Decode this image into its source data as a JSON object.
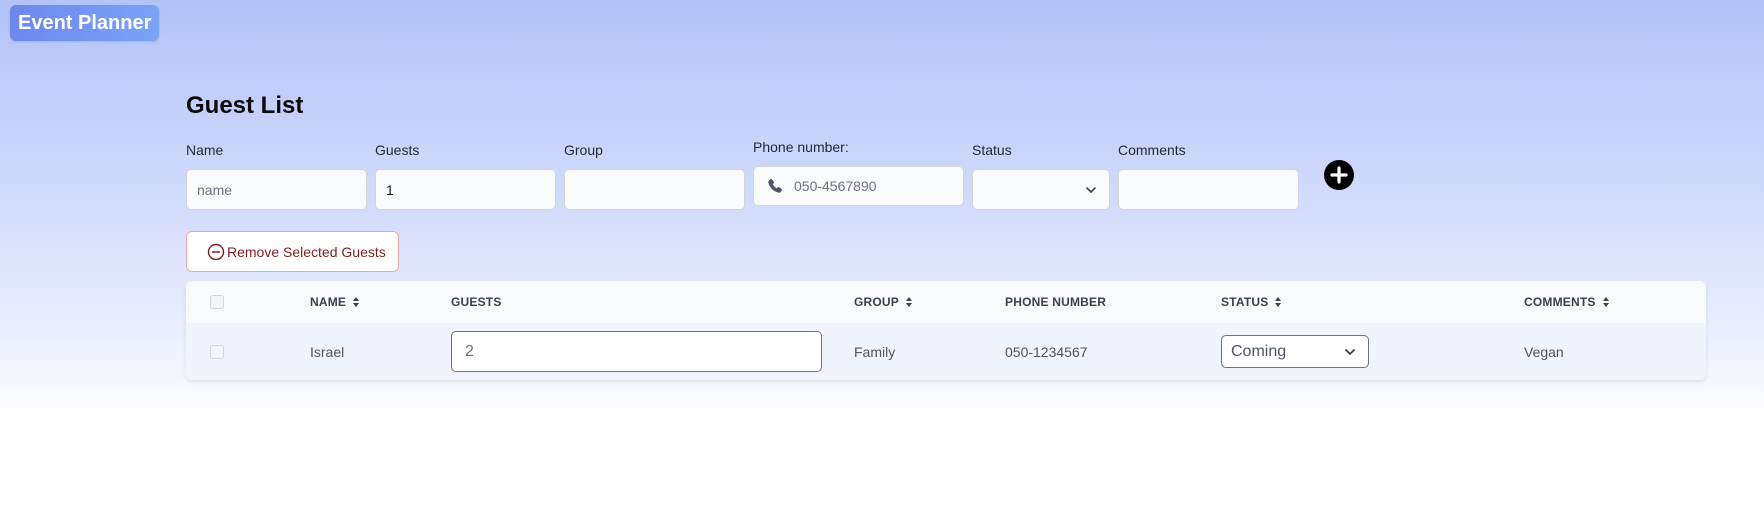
{
  "app": {
    "title": "Event Planner"
  },
  "page": {
    "title": "Guest List"
  },
  "form": {
    "name": {
      "label": "Name",
      "value": "",
      "placeholder": "name"
    },
    "guests": {
      "label": "Guests",
      "value": "1"
    },
    "group": {
      "label": "Group",
      "value": ""
    },
    "phone": {
      "label": "Phone number:",
      "value": "",
      "placeholder": "050-4567890",
      "icon": "phone-icon"
    },
    "status": {
      "label": "Status",
      "value": ""
    },
    "comments": {
      "label": "Comments",
      "value": ""
    },
    "add_icon": "plus-circle-icon"
  },
  "actions": {
    "remove_selected_label": "Remove Selected Guests",
    "remove_icon": "minus-circle-icon"
  },
  "table": {
    "columns": [
      {
        "key": "name",
        "label": "NAME",
        "sortable": true
      },
      {
        "key": "guests",
        "label": "GUESTS",
        "sortable": false
      },
      {
        "key": "group",
        "label": "GROUP",
        "sortable": true
      },
      {
        "key": "phone",
        "label": "PHONE NUMBER",
        "sortable": false
      },
      {
        "key": "status",
        "label": "STATUS",
        "sortable": true
      },
      {
        "key": "comments",
        "label": "COMMENTS",
        "sortable": true
      }
    ],
    "rows": [
      {
        "selected": false,
        "name": "Israel",
        "guests": "2",
        "group": "Family",
        "phone": "050-1234567",
        "status": "Coming",
        "comments": "Vegan"
      }
    ]
  },
  "colors": {
    "brand_gradient_start": "#6e86f0",
    "brand_gradient_end": "#7aa4f7",
    "remove_button_border": "#f3a5a5",
    "remove_button_text": "#7f1d1d"
  }
}
